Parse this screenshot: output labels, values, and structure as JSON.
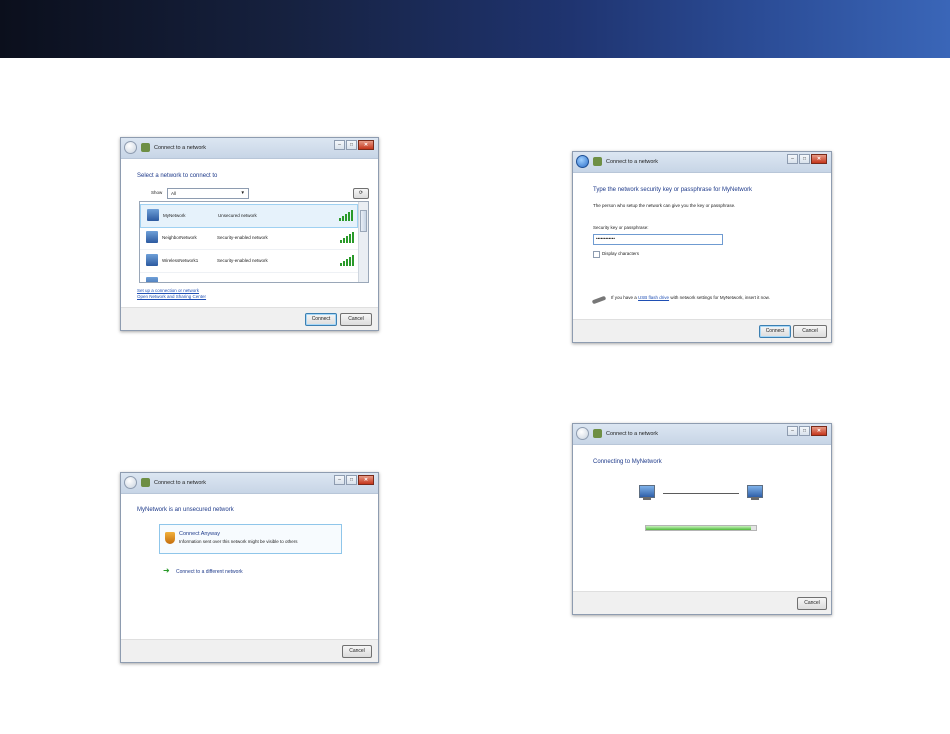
{
  "dialog_title": "Connect to a network",
  "dialog1": {
    "heading": "Select a network to connect to",
    "show_label": "Show",
    "show_value": "All",
    "networks": [
      {
        "name": "MyNetwork",
        "security": "Unsecured network"
      },
      {
        "name": "NeighborNetwork",
        "security": "Security-enabled network"
      },
      {
        "name": "WirelessNetwork1",
        "security": "Security-enabled network"
      }
    ],
    "links": [
      "Set up a connection or network",
      "Open Network and Sharing Center"
    ],
    "connect_btn": "Connect",
    "cancel_btn": "Cancel"
  },
  "dialog2": {
    "heading": "Type the network security key or passphrase for MyNetwork",
    "desc": "The person who setup the network can give you the key or passphrase.",
    "field_label": "Security key or passphrase:",
    "field_value": "••••••••••••",
    "checkbox_label": "Display characters",
    "usb_text_pre": "If you have a",
    "usb_link": "USB flash drive",
    "usb_text_post": "with network settings for MyNetwork, insert it now.",
    "connect_btn": "Connect",
    "cancel_btn": "Cancel"
  },
  "dialog3": {
    "heading": "MyNetwork is an unsecured network",
    "option_title": "Connect Anyway",
    "option_desc": "Information sent over this network might be visible to others",
    "other_option": "Connect to a different network",
    "cancel_btn": "Cancel"
  },
  "dialog4": {
    "heading": "Connecting to MyNetwork",
    "progress": 0.95,
    "cancel_btn": "Cancel"
  }
}
